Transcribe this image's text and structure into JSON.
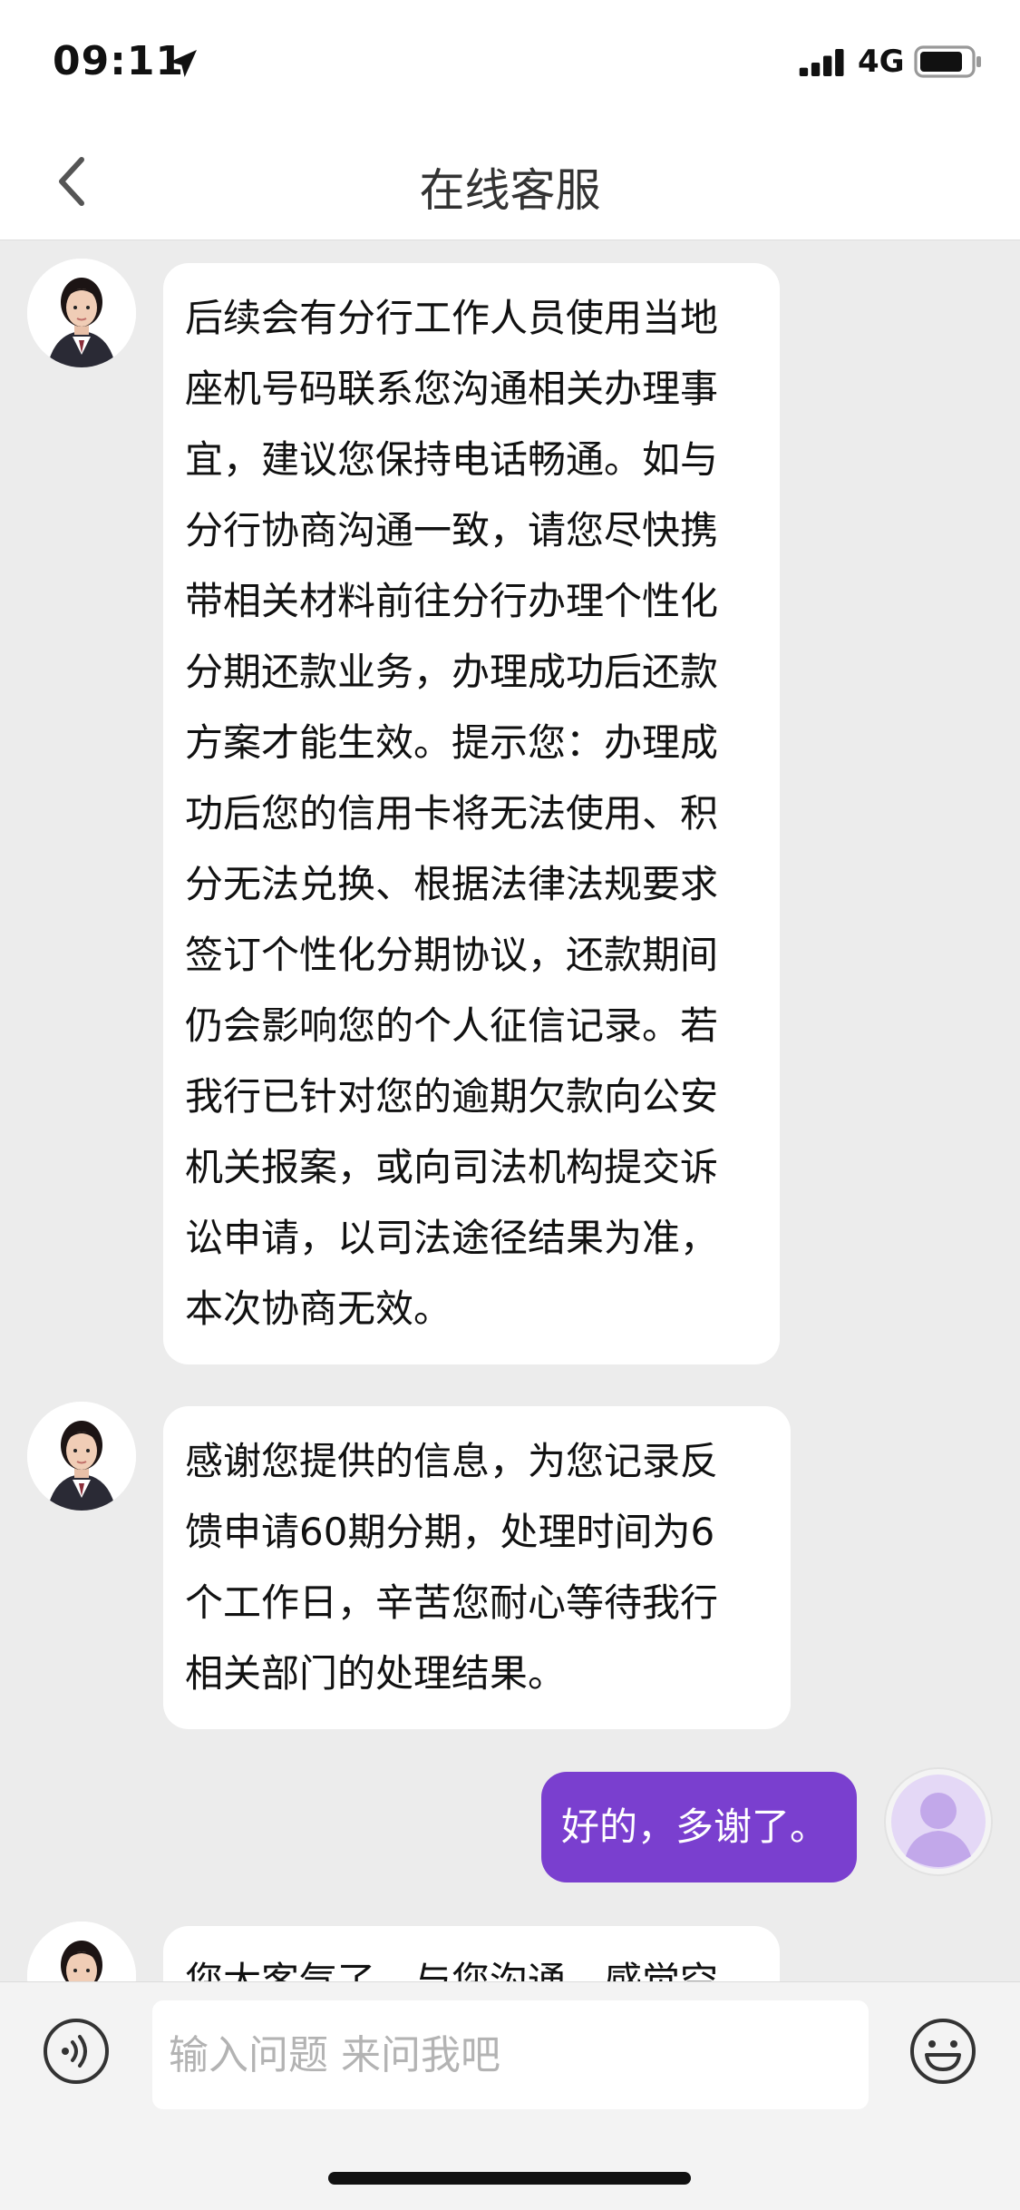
{
  "status_bar": {
    "time": "09:11",
    "network": "4G",
    "icons": [
      "location-arrow-icon",
      "signal-icon",
      "battery-icon"
    ]
  },
  "nav": {
    "title": "在线客服",
    "back_icon": "chevron-left-icon"
  },
  "messages": [
    {
      "sender": "agent",
      "text": "后续会有分行工作人员使用当地\n座机号码联系您沟通相关办理事\n宜，建议您保持电话畅通。如与\n分行协商沟通一致，请您尽快携\n带相关材料前往分行办理个性化\n分期还款业务，办理成功后还款\n方案才能生效。提示您：办理成\n功后您的信用卡将无法使用、积\n分无法兑换、根据法律法规要求\n签订个性化分期协议，还款期间\n仍会影响您的个人征信记录。若\n我行已针对您的逾期欠款向公安\n机关报案，或向司法机构提交诉\n讼申请，以司法途径结果为准，\n本次协商无效。"
    },
    {
      "sender": "agent",
      "text": "感谢您提供的信息，为您记录反\n馈申请60期分期，处理时间为6\n个工作日，辛苦您耐心等待我行\n相关部门的处理结果。"
    },
    {
      "sender": "user",
      "text": "好的，多谢了。"
    },
    {
      "sender": "agent",
      "text": "您太客气了，与您沟通，感觉空"
    }
  ],
  "input_bar": {
    "placeholder": "输入问题 来问我吧",
    "value": "",
    "left_icon": "voice-icon",
    "right_icon": "emoji-icon"
  },
  "colors": {
    "user_bubble": "#7a3fcf",
    "background": "#ececec"
  }
}
